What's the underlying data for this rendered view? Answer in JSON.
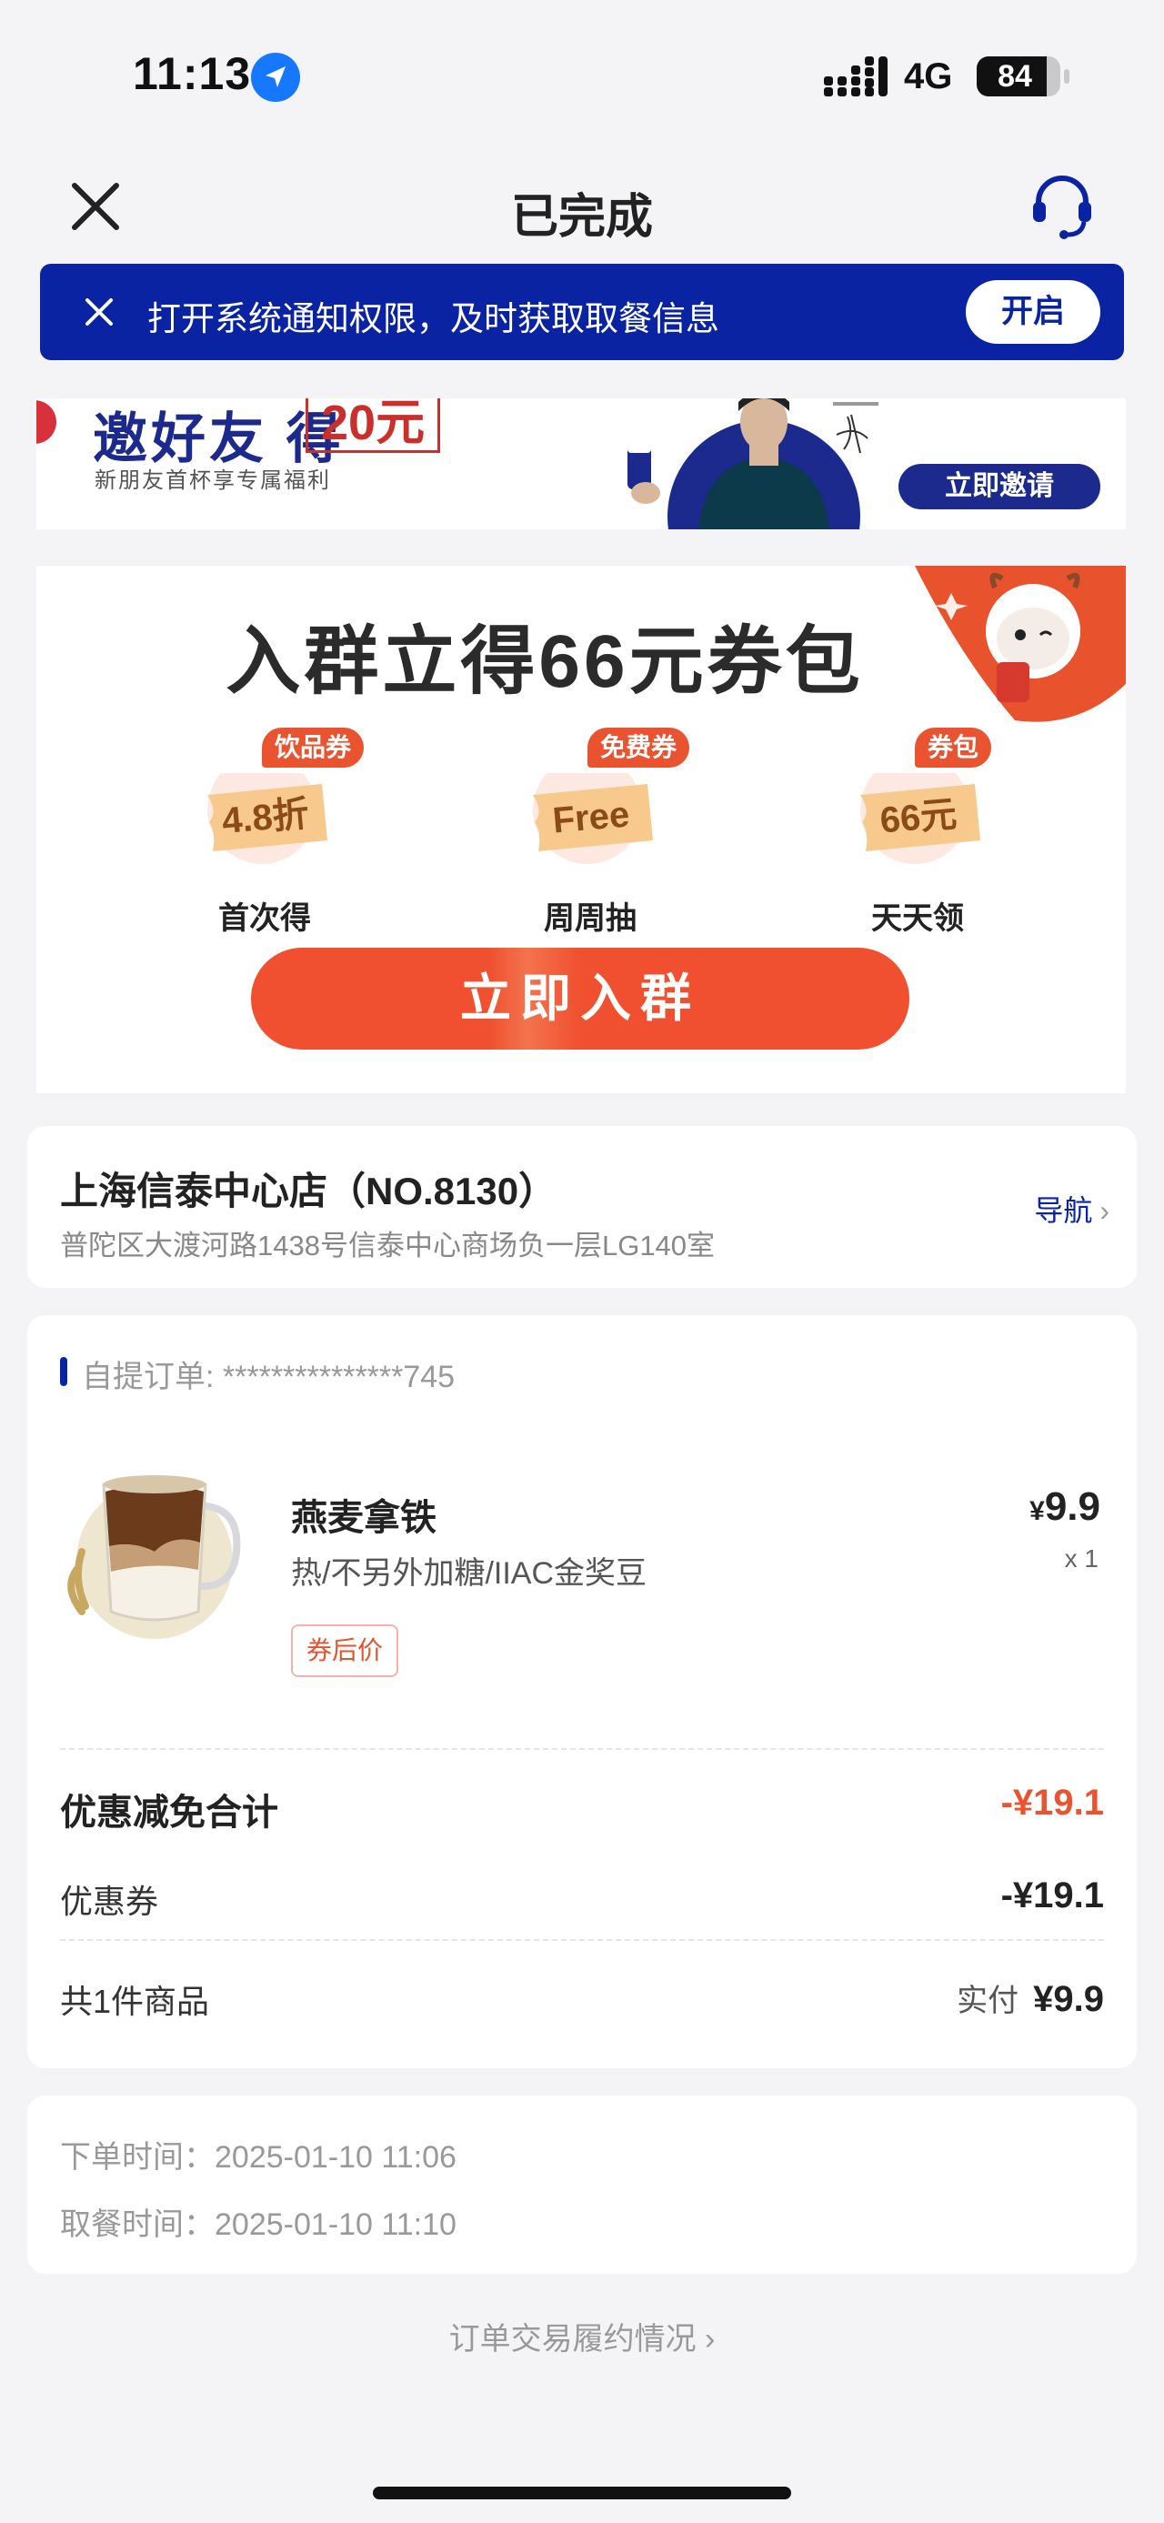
{
  "status_bar": {
    "time": "11:13",
    "network": "4G",
    "battery_level": 84,
    "battery_label": "84"
  },
  "nav": {
    "title": "已完成"
  },
  "notify_banner": {
    "text": "打开系统通知权限，及时获取取餐信息",
    "button": "开启"
  },
  "invite_banner": {
    "title": "邀好友 得",
    "amount": "20元",
    "subtitle": "新朋友首杯享专属福利",
    "button": "立即邀请"
  },
  "group_promo": {
    "title": "入群立得66元券包",
    "perks": [
      {
        "tag": "饮品券",
        "ticket_text": "4.8折",
        "label": "首次得"
      },
      {
        "tag": "免费券",
        "ticket_text": "Free",
        "label": "周周抽"
      },
      {
        "tag": "券包",
        "ticket_text": "66元",
        "label": "天天领"
      }
    ],
    "button": "立即入群"
  },
  "store": {
    "name": "上海信泰中心店（NO.8130）",
    "address": "普陀区大渡河路1438号信泰中心商场负一层LG140室",
    "nav_label": "导航"
  },
  "order": {
    "id_label": "自提订单: ***************745",
    "product": {
      "name": "燕麦拿铁",
      "spec": "热/不另外加糖/IIAC金奖豆",
      "tag": "券后价",
      "currency": "¥",
      "price": "9.9",
      "qty": "x 1"
    },
    "discount_total_label": "优惠减免合计",
    "discount_total_value": "-¥19.1",
    "coupon_label": "优惠券",
    "coupon_value": "-¥19.1",
    "items_label": "共1件商品",
    "paid_label": "实付",
    "paid_value": "¥9.9"
  },
  "times": {
    "order_time": "下单时间：2025-01-10 11:06",
    "pickup_time": "取餐时间：2025-01-10 11:10"
  },
  "footer_link": "订单交易履约情况 ›",
  "colors": {
    "brand_blue": "#0a23a3",
    "accent_orange": "#ea5330",
    "page_bg": "#f4f4f6"
  }
}
